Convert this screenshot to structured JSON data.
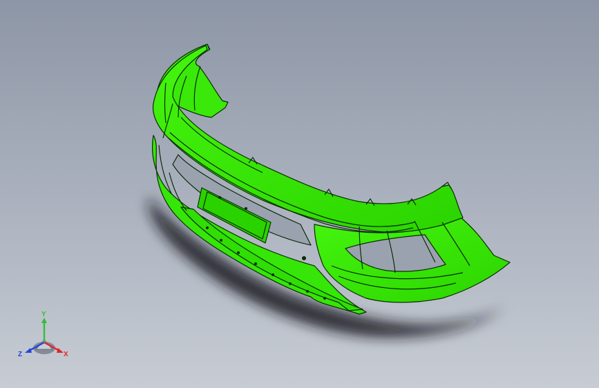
{
  "viewport": {
    "background_top": "#8d96a6",
    "background_bottom": "#c7ccd4"
  },
  "model": {
    "part_color": "#33ee00",
    "edge_color": "#0a2a05",
    "shadow_color": "#1a1d24"
  },
  "triad": {
    "x_label": "X",
    "y_label": "Y",
    "z_label": "Z",
    "x_color": "#e3262a",
    "y_color": "#2fbf3a",
    "z_color": "#2446d6"
  }
}
